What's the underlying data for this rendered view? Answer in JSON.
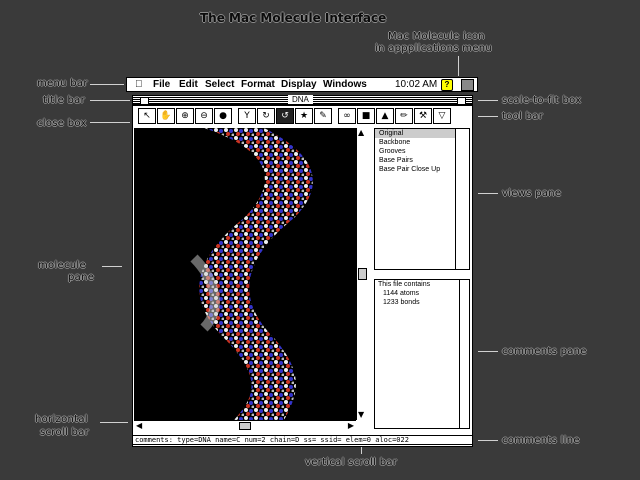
{
  "header": {
    "title": "The Mac Molecule Interface"
  },
  "annotations": {
    "icon_note_1": "Mac Molecule icon",
    "icon_note_2": "in appplications menu",
    "menu_bar": "menu bar",
    "title_bar": "title bar",
    "close_box": "close box",
    "scale_to_fit": "scale-to-fit box",
    "tool_bar": "tool bar",
    "views_pane": "views pane",
    "molecule_pane_1": "molecule",
    "molecule_pane_2": "pane",
    "comments_pane": "comments pane",
    "horizontal_1": "horizontal",
    "horizontal_2": "scroll bar",
    "comments_line": "comments line",
    "vertical_scroll": "vertical scroll bar"
  },
  "menubar": {
    "items": [
      "File",
      "Edit",
      "Select",
      "Format",
      "Display",
      "Windows"
    ],
    "clock": "10:02 AM"
  },
  "window": {
    "title": "DNA"
  },
  "views": {
    "items": [
      "Original",
      "Backbone",
      "Grooves",
      "Base Pairs",
      "Base Pair Close Up"
    ],
    "selected": "Original"
  },
  "comments": {
    "lines": [
      "This file contains",
      "1144 atoms",
      "1233 bonds"
    ]
  },
  "comment_line": "comments: type=DNA  name=C  num=2  chain=D  ss=  ssid=  elem=0  aloc=022"
}
